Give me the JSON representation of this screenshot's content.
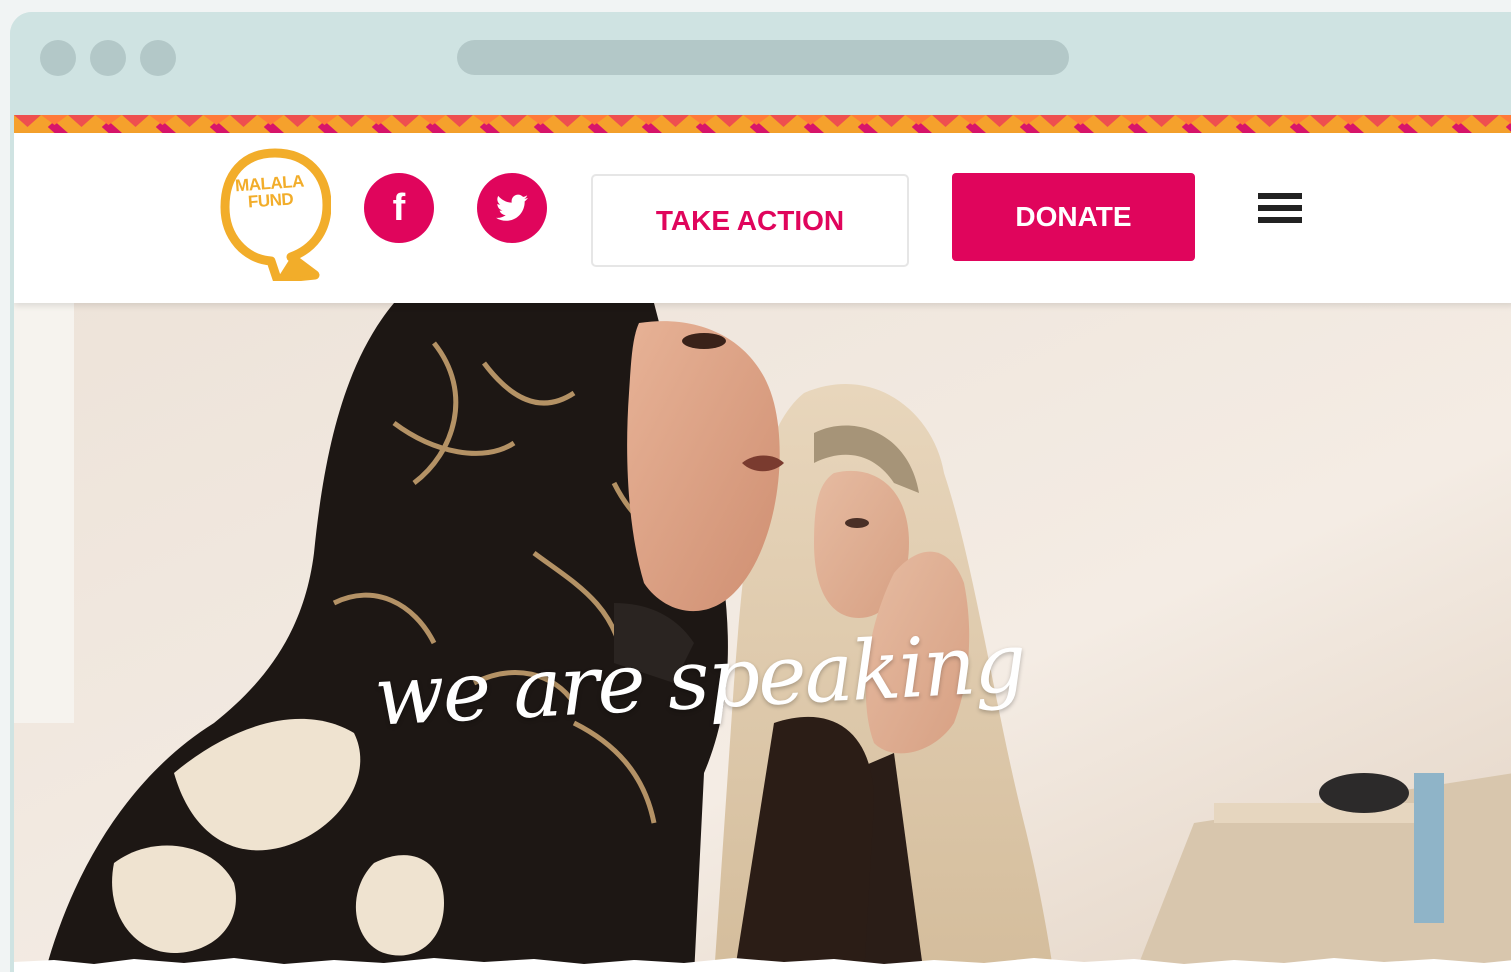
{
  "browser": {
    "window_controls": [
      "close",
      "minimize",
      "maximize"
    ]
  },
  "header": {
    "logo_text_line1": "MALALA",
    "logo_text_line2": "FUND",
    "social_links": [
      {
        "icon": "facebook-icon",
        "glyph": "f"
      },
      {
        "icon": "twitter-icon"
      }
    ],
    "take_action_label": "TAKE ACTION",
    "donate_label": "DONATE",
    "menu_icon": "hamburger-icon"
  },
  "hero": {
    "caption": "we are speaking"
  },
  "colors": {
    "brand_pink": "#e0055c",
    "brand_yellow": "#f2ad2a",
    "zigzag_orange": "#f79a2c",
    "browser_chrome": "#cfe3e2"
  }
}
